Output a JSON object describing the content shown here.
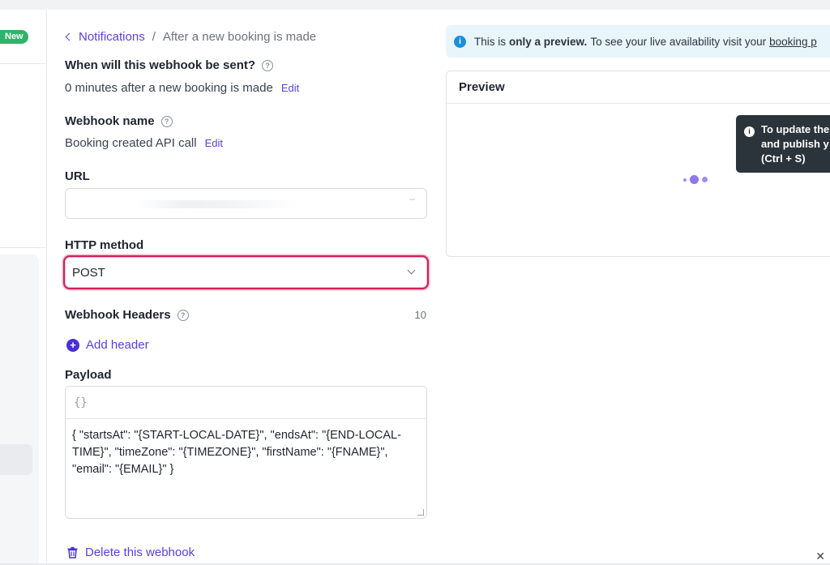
{
  "sidebar": {
    "new_badge": "New"
  },
  "breadcrumb": {
    "parent": "Notifications",
    "separator": "/",
    "current": "After a new booking is made"
  },
  "when_sent": {
    "label": "When will this webhook be sent?",
    "value": "0 minutes after a new booking is made",
    "edit": "Edit"
  },
  "webhook_name": {
    "label": "Webhook name",
    "value": "Booking created API call",
    "edit": "Edit"
  },
  "url": {
    "label": "URL",
    "value": "",
    "suffix": "--"
  },
  "http_method": {
    "label": "HTTP method",
    "selected": "POST"
  },
  "webhook_headers": {
    "label": "Webhook Headers",
    "count": "10",
    "add_label": "Add header"
  },
  "payload": {
    "label": "Payload",
    "toolbar_icon": "{}",
    "text": "{ \"startsAt\": \"{START-LOCAL-DATE}\", \"endsAt\": \"{END-LOCAL-TIME}\", \"timeZone\": \"{TIMEZONE}\", \"firstName\": \"{FNAME}\", \"email\": \"{EMAIL}\" }"
  },
  "delete_label": "Delete this webhook",
  "info_bar": {
    "text_start": "This is",
    "bold": "only a preview.",
    "text_end": "To see your live availability visit your",
    "link": "booking p"
  },
  "preview": {
    "title": "Preview"
  },
  "tooltip": {
    "line1": "To update the",
    "line2": "and publish y",
    "line3": "(Ctrl + S)"
  },
  "icons": [
    "chevron-left-icon",
    "help-icon",
    "chevron-down-icon",
    "plus-circle-icon",
    "code-braces-icon",
    "trash-icon",
    "info-icon",
    "close-icon"
  ],
  "colors": {
    "accent": "#5b3fd9",
    "focus_ring": "#d21f5a",
    "badge_green": "#2fb36b",
    "info_bg": "#e8f5fb",
    "tooltip_bg": "#2b333b"
  }
}
